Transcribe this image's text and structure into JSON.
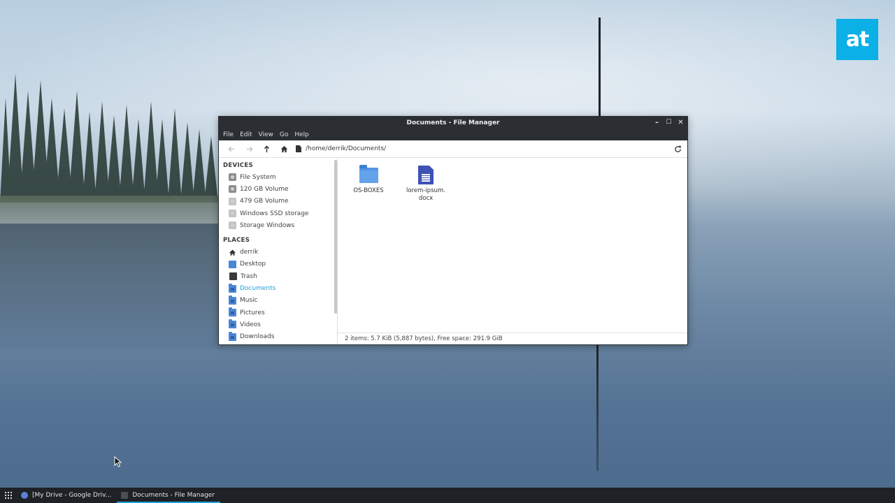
{
  "window": {
    "title": "Documents - File Manager",
    "minimize": "–",
    "maximize": "☐",
    "close": "✕"
  },
  "menu": [
    "File",
    "Edit",
    "View",
    "Go",
    "Help"
  ],
  "toolbar": {
    "path": "/home/derrik/Documents/"
  },
  "sidebar": {
    "devices_label": "DEVICES",
    "devices": [
      "File System",
      "120 GB Volume",
      "479 GB Volume",
      "Windows SSD storage",
      "Storage Windows"
    ],
    "places_label": "PLACES",
    "places": [
      "derrik",
      "Desktop",
      "Trash",
      "Documents",
      "Music",
      "Pictures",
      "Videos",
      "Downloads"
    ]
  },
  "files": [
    {
      "name": "OS-BOXES",
      "type": "folder"
    },
    {
      "name": "lorem-ipsum.docx",
      "type": "document"
    }
  ],
  "status": "2 items: 5.7 KiB (5,887 bytes), Free space: 291.9 GiB",
  "taskbar": {
    "task1": "[My Drive - Google Driv...",
    "task2": "Documents - File Manager"
  },
  "logo": "at",
  "colors": {
    "accent": "#1fa0d9",
    "folder": "#5294e2",
    "logo": "#0ab0e6"
  }
}
